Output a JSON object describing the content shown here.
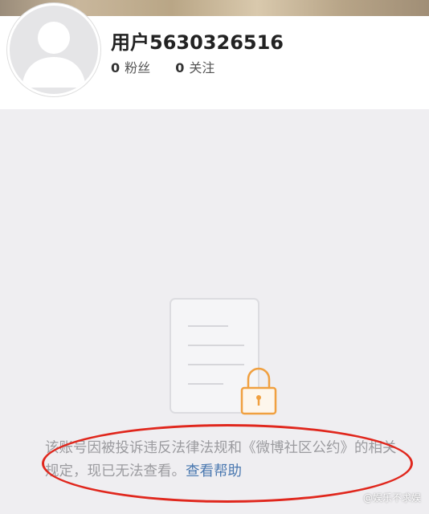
{
  "profile": {
    "username": "用户5630326516",
    "followers_count": "0",
    "followers_label": "粉丝",
    "following_count": "0",
    "following_label": "关注"
  },
  "notice": {
    "message": "该账号因被投诉违反法律法规和《微博社区公约》的相关规定，现已无法查看。",
    "help_link": "查看帮助"
  },
  "icons": {
    "avatar": "default-avatar-icon",
    "illustration": "locked-document-icon"
  },
  "colors": {
    "link": "#4a78b0",
    "lock": "#f0a040",
    "highlight": "#e0271d"
  },
  "watermark": "@娱乐不求娱"
}
